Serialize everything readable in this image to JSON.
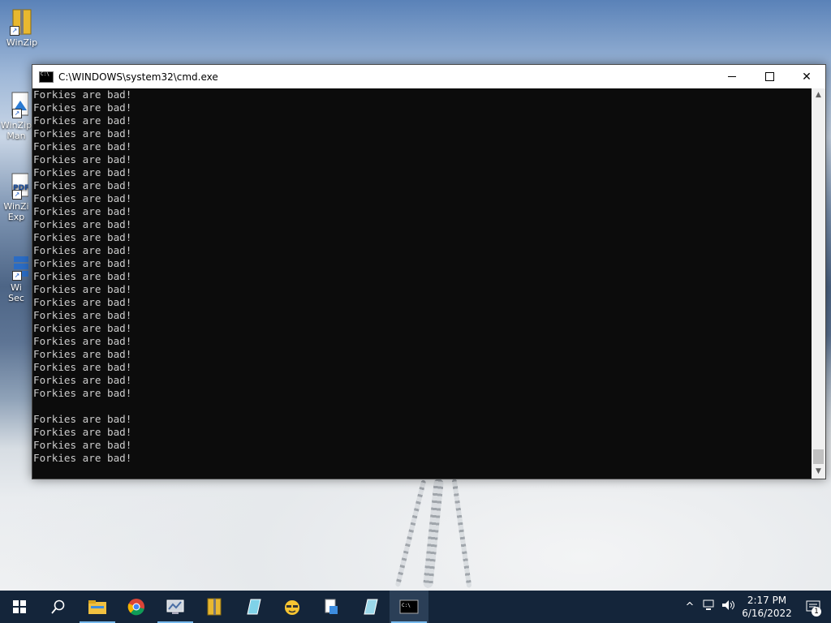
{
  "desktop": {
    "icons": [
      {
        "label": "WinZip"
      },
      {
        "label": "WinZip\nMan"
      },
      {
        "label": "WinZi\nExp"
      },
      {
        "label": "Wi\nSec"
      }
    ]
  },
  "window": {
    "title": "C:\\WINDOWS\\system32\\cmd.exe",
    "minimize": "—",
    "close": "✕"
  },
  "console": {
    "lines": [
      "Forkies are bad!",
      "Forkies are bad!",
      "Forkies are bad!",
      "Forkies are bad!",
      "Forkies are bad!",
      "Forkies are bad!",
      "Forkies are bad!",
      "Forkies are bad!",
      "Forkies are bad!",
      "Forkies are bad!",
      "Forkies are bad!",
      "Forkies are bad!",
      "Forkies are bad!",
      "Forkies are bad!",
      "Forkies are bad!",
      "Forkies are bad!",
      "Forkies are bad!",
      "Forkies are bad!",
      "Forkies are bad!",
      "Forkies are bad!",
      "Forkies are bad!",
      "Forkies are bad!",
      "Forkies are bad!",
      "Forkies are bad!",
      "",
      "Forkies are bad!",
      "Forkies are bad!",
      "Forkies are bad!",
      "Forkies are bad!"
    ]
  },
  "taskbar": {
    "apps": [
      "start-icon",
      "search-icon",
      "file-explorer-icon",
      "chrome-icon",
      "network-app-icon",
      "winzip-icon",
      "notes-icon",
      "emoji-app-icon",
      "file-icon",
      "notes2-icon",
      "cmd-icon"
    ],
    "clock": {
      "time": "2:17 PM",
      "date": "6/16/2022"
    },
    "notification_count": "1"
  }
}
